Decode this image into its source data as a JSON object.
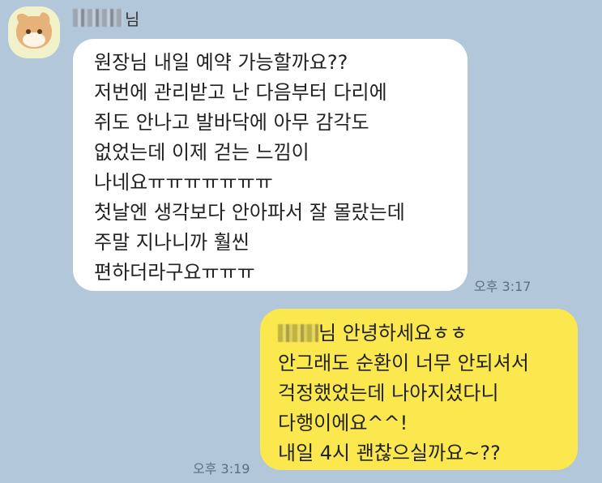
{
  "incoming": {
    "sender_suffix": "님",
    "lines": [
      "원장님 내일 예약 가능할까요??",
      "저번에 관리받고 난 다음부터 다리에",
      "쥐도 안나고 발바닥에 아무 감각도",
      "없었는데 이제 걷는 느낌이",
      "나네요ㅠㅠㅠㅠㅠㅠㅠ",
      "첫날엔 생각보다 안아파서 잘 몰랐는데",
      "주말 지나니까 훨씬",
      "편하더라구요ㅠㅠㅠ"
    ],
    "time": "오후 3:17"
  },
  "outgoing": {
    "first_line_rest": "님 안녕하세요ㅎㅎ",
    "lines": [
      "안그래도 순환이 너무 안되셔서",
      "걱정했었는데 나아지셨다니",
      "다행이에요^^!",
      "내일 4시 괜찮으실까요~??"
    ],
    "time": "오후 3:19"
  }
}
